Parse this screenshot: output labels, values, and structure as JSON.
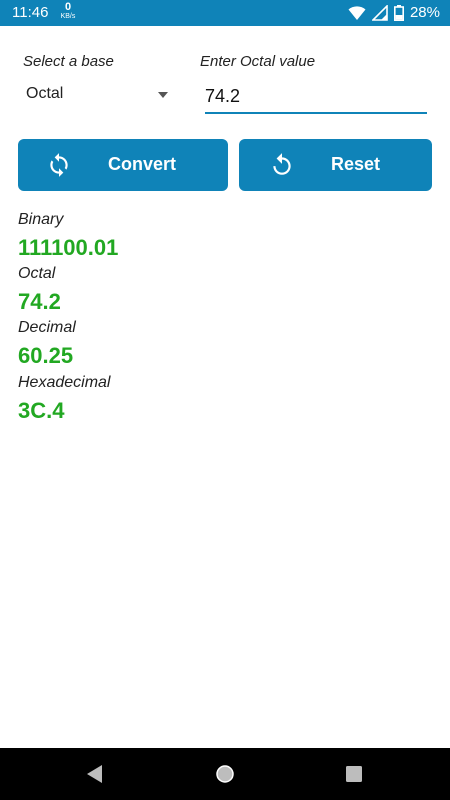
{
  "status_bar": {
    "time": "11:46",
    "net_speed_value": "0",
    "net_speed_unit": "KB/s",
    "battery_percent": "28%",
    "icons": [
      "wifi-icon",
      "signal-icon",
      "battery-icon"
    ]
  },
  "inputs": {
    "base_label": "Select a base",
    "base_selected": "Octal",
    "value_label": "Enter Octal value",
    "value": "74.2"
  },
  "buttons": {
    "convert_label": "Convert",
    "reset_label": "Reset"
  },
  "results": [
    {
      "label": "Binary",
      "value": "111100.01"
    },
    {
      "label": "Octal",
      "value": "74.2"
    },
    {
      "label": "Decimal",
      "value": "60.25"
    },
    {
      "label": "Hexadecimal",
      "value": "3C.4"
    }
  ],
  "colors": {
    "accent": "#0f83b8",
    "result_green": "#22a822",
    "navbar": "#000000"
  }
}
